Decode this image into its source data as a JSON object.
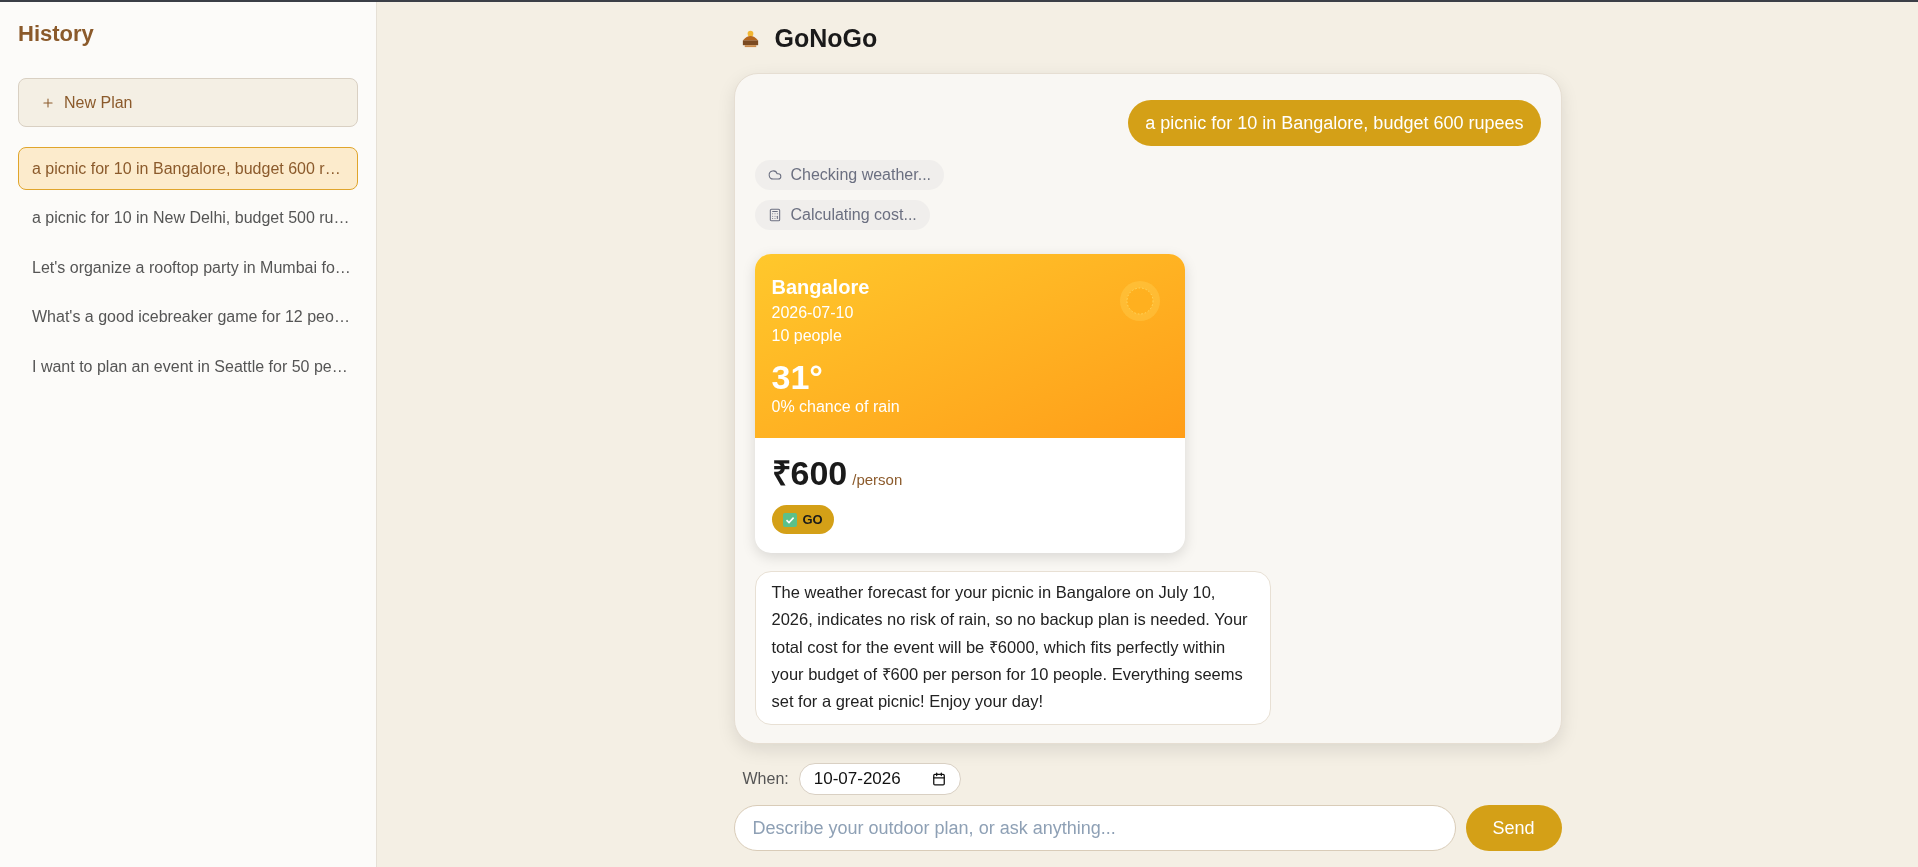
{
  "sidebar": {
    "title": "History",
    "new_plan_button": "New Plan",
    "items": [
      {
        "label": "a picnic for 10 in Bangalore, budget 600 r…",
        "selected": true
      },
      {
        "label": "a picnic for 10 in New Delhi, budget 500 ru…",
        "selected": false
      },
      {
        "label": "Let's organize a rooftop party in Mumbai fo…",
        "selected": false
      },
      {
        "label": "What's a good icebreaker game for 12 peo…",
        "selected": false
      },
      {
        "label": "I want to plan an event in Seattle for 50 pe…",
        "selected": false
      }
    ]
  },
  "header": {
    "title": "GoNoGo"
  },
  "chat": {
    "user_message": "a picnic for 10 in Bangalore, budget 600 rupees",
    "steps": [
      {
        "kind": "weather",
        "label": "Checking weather..."
      },
      {
        "kind": "cost",
        "label": "Calculating cost..."
      }
    ],
    "weather_card": {
      "city": "Bangalore",
      "date": "2026-07-10",
      "people": "10 people",
      "temperature": "31°",
      "rain": "0% chance of rain",
      "price": "₹600",
      "price_unit": "/person",
      "verdict": "GO"
    },
    "reply": "The weather forecast for your picnic in Bangalore on July 10, 2026, indicates no risk of rain, so no backup plan is needed. Your total cost for the event will be ₹6000, which fits perfectly within your budget of ₹600 per person for 10 people. Everything seems set for a great picnic! Enjoy your day!"
  },
  "composer": {
    "date_label": "When:",
    "date_value": "10-07-2026",
    "placeholder": "Describe your outdoor plan, or ask anything...",
    "send_button": "Send"
  }
}
